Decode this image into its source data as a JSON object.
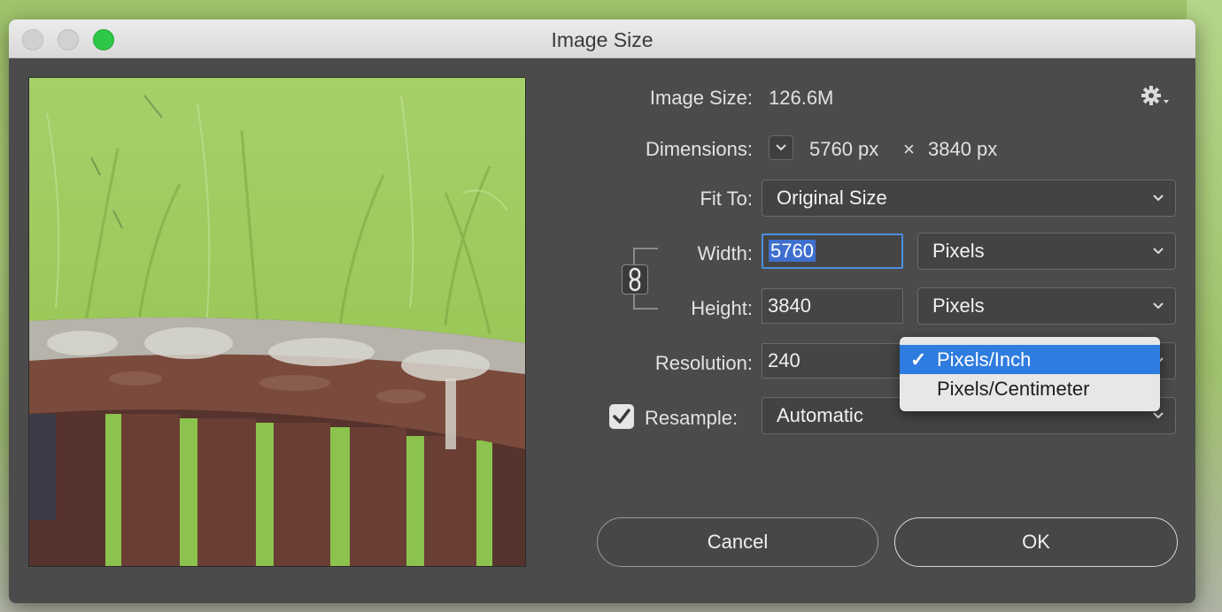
{
  "window": {
    "title": "Image Size"
  },
  "image_size": {
    "label": "Image Size:",
    "value": "126.6M"
  },
  "dimensions": {
    "label": "Dimensions:",
    "width": "5760 px",
    "times": "×",
    "height": "3840 px"
  },
  "fit_to": {
    "label": "Fit To:",
    "value": "Original Size"
  },
  "width": {
    "label": "Width:",
    "value": "5760",
    "unit": "Pixels"
  },
  "height": {
    "label": "Height:",
    "value": "3840",
    "unit": "Pixels"
  },
  "resolution": {
    "label": "Resolution:",
    "value": "240"
  },
  "resample": {
    "label": "Resample:",
    "checked": true,
    "value": "Automatic"
  },
  "resolution_menu": {
    "items": [
      {
        "label": "Pixels/Inch",
        "check": "✓",
        "selected": true
      },
      {
        "label": "Pixels/Centimeter",
        "selected": false
      }
    ]
  },
  "buttons": {
    "cancel": "Cancel",
    "ok": "OK"
  },
  "icons": {
    "settings": "gear-icon",
    "chain": "link-icon",
    "dimensions_toggle": "chevron-down-icon"
  },
  "colors": {
    "accent": "#2f7ce0",
    "focus_ring": "#4a8fe0",
    "traffic_zoom": "#2ec748"
  }
}
